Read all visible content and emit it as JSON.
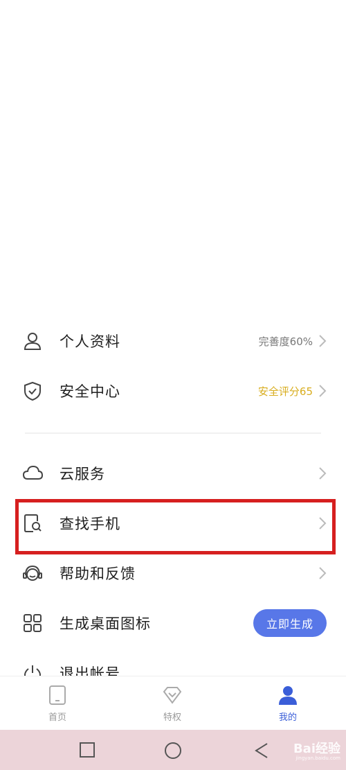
{
  "menu": {
    "profile": {
      "label": "个人资料",
      "right_text": "完善度60%",
      "icon": "user-icon"
    },
    "security": {
      "label": "安全中心",
      "right_text": "安全评分65",
      "icon": "shield-check-icon",
      "accent": "#d8ad1e"
    },
    "cloud": {
      "label": "云服务",
      "icon": "cloud-icon"
    },
    "find_phone": {
      "label": "查找手机",
      "icon": "phone-search-icon"
    },
    "help": {
      "label": "帮助和反馈",
      "icon": "headset-icon"
    },
    "shortcut": {
      "label": "生成桌面图标",
      "button": "立即生成",
      "icon": "grid-icon",
      "button_color": "#5877e8"
    },
    "logout": {
      "label": "退出帐号",
      "icon": "power-icon"
    }
  },
  "highlight_color": "#d61f1f",
  "tabbar": {
    "tabs": [
      {
        "label": "首页",
        "icon": "phone-icon",
        "active": false
      },
      {
        "label": "特权",
        "icon": "diamond-icon",
        "active": false
      },
      {
        "label": "我的",
        "icon": "person-icon",
        "active": true
      }
    ],
    "active_color": "#3a5ed8"
  },
  "system_nav": {
    "buttons": [
      "square-icon",
      "circle-icon",
      "back-triangle-icon"
    ]
  },
  "watermark": {
    "brand": "Bai经验",
    "url": "jingyan.baidu.com"
  }
}
